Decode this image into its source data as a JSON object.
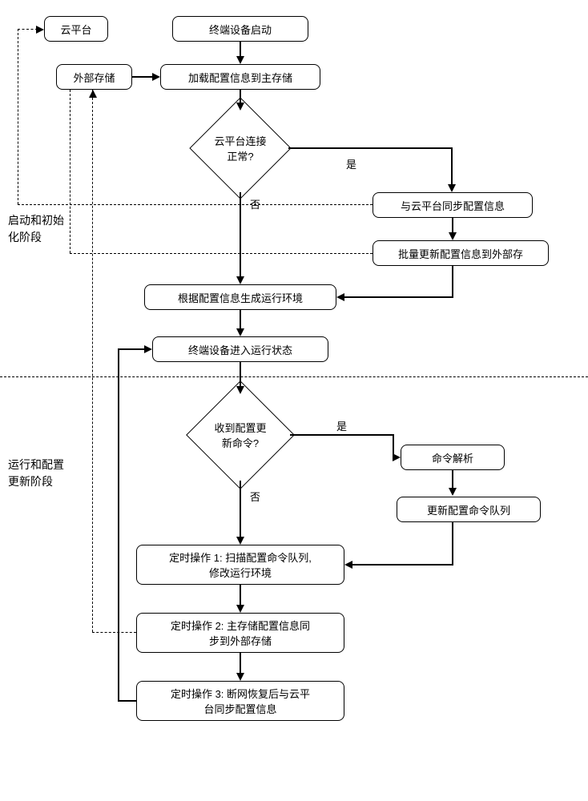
{
  "nodes": {
    "cloud": "云平台",
    "extStorage": "外部存储",
    "start": "终端设备启动",
    "loadConfig": "加载配置信息到主存储",
    "cloudOk": "云平台连接\n正常?",
    "syncCloud": "与云平台同步配置信息",
    "batchUpdate": "批量更新配置信息到外部存",
    "genEnv": "根据配置信息生成运行环境",
    "runState": "终端设备进入运行状态",
    "recvCmd": "收到配置更\n新命令?",
    "parseCmd": "命令解析",
    "updateQueue": "更新配置命令队列",
    "timer1": "定时操作 1: 扫描配置命令队列,\n修改运行环境",
    "timer2": "定时操作 2: 主存储配置信息同\n步到外部存储",
    "timer3": "定时操作 3: 断网恢复后与云平\n台同步配置信息"
  },
  "labels": {
    "yes1": "是",
    "no1": "否",
    "yes2": "是",
    "no2": "否"
  },
  "phases": {
    "phase1": "启动和初始\n化阶段",
    "phase2": "运行和配置\n更新阶段"
  }
}
